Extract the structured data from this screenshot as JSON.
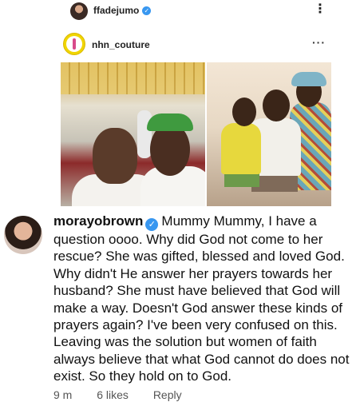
{
  "top_user": {
    "username": "ffadejumo",
    "verified_icon": "verified-badge-icon",
    "menu_icon": "more-vertical-icon"
  },
  "embedded_post": {
    "username": "nhn_couture",
    "menu_icon": "more-horizontal-icon"
  },
  "comment": {
    "username": "morayobrown",
    "verified_icon": "verified-badge-icon",
    "text": "Mummy Mummy, I have a question oooo. Why did God not come to her rescue? She was gifted, blessed and loved God. Why didn't He answer her prayers towards her husband? She must have believed that God will make a way. Doesn't God answer these kinds of prayers again? I've been very confused on this. Leaving was the solution but women of faith always believe that what God cannot do does not exist. So they hold on to God.",
    "time": "9 m",
    "likes": "6 likes",
    "reply_label": "Reply"
  },
  "colors": {
    "verified": "#3897f0",
    "meta_text": "#555555"
  }
}
